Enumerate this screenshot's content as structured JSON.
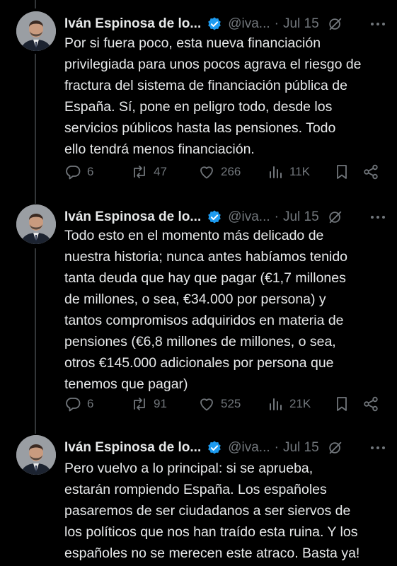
{
  "tweets": [
    {
      "author_name": "Iván Espinosa de lo...",
      "handle": "@iva...",
      "separator": "·",
      "date": "Jul 15",
      "text": "Por si fuera poco, esta nueva financiación\nprivilegiada para unos pocos agrava el riesgo de\nfractura del sistema de financiación pública de\nEspaña. Sí, pone en peligro todo, desde los\nservicios públicos hasta las pensiones. Todo\nello tendrá menos financiación.",
      "replies": "6",
      "reposts": "47",
      "likes": "266",
      "views": "11K"
    },
    {
      "author_name": "Iván Espinosa de lo...",
      "handle": "@iva...",
      "separator": "·",
      "date": "Jul 15",
      "text": "Todo esto en el momento más delicado de\nnuestra historia; nunca antes habíamos tenido\ntanta deuda que hay que pagar (€1,7 millones\nde millones, o sea, €34.000 por persona) y\ntantos compromisos adquiridos en materia de\npensiones (€6,8 millones de millones, o sea,\notros €145.000 adicionales por persona que\ntenemos que pagar)",
      "replies": "6",
      "reposts": "91",
      "likes": "525",
      "views": "21K"
    },
    {
      "author_name": "Iván Espinosa de lo...",
      "handle": "@iva...",
      "separator": "·",
      "date": "Jul 15",
      "text": "Pero vuelvo a lo principal: si se aprueba,\nestarán rompiendo España. Los españoles\npasaremos de ser ciudadanos a ser siervos de\nlos políticos que nos han traído esta ruina. Y los\nespañoles no se merecen este atraco. Basta ya!"
    }
  ],
  "icons": {
    "verified": "verified-badge-icon",
    "grok": "grok-icon",
    "more": "more-icon",
    "reply": "reply-icon",
    "repost": "repost-icon",
    "like": "like-icon",
    "views": "views-icon",
    "bookmark": "bookmark-icon",
    "share": "share-icon"
  },
  "colors": {
    "background": "#000000",
    "text": "#e7e9ea",
    "secondary": "#71767b",
    "verified": "#1d9bf0",
    "thread_line": "#333639"
  }
}
